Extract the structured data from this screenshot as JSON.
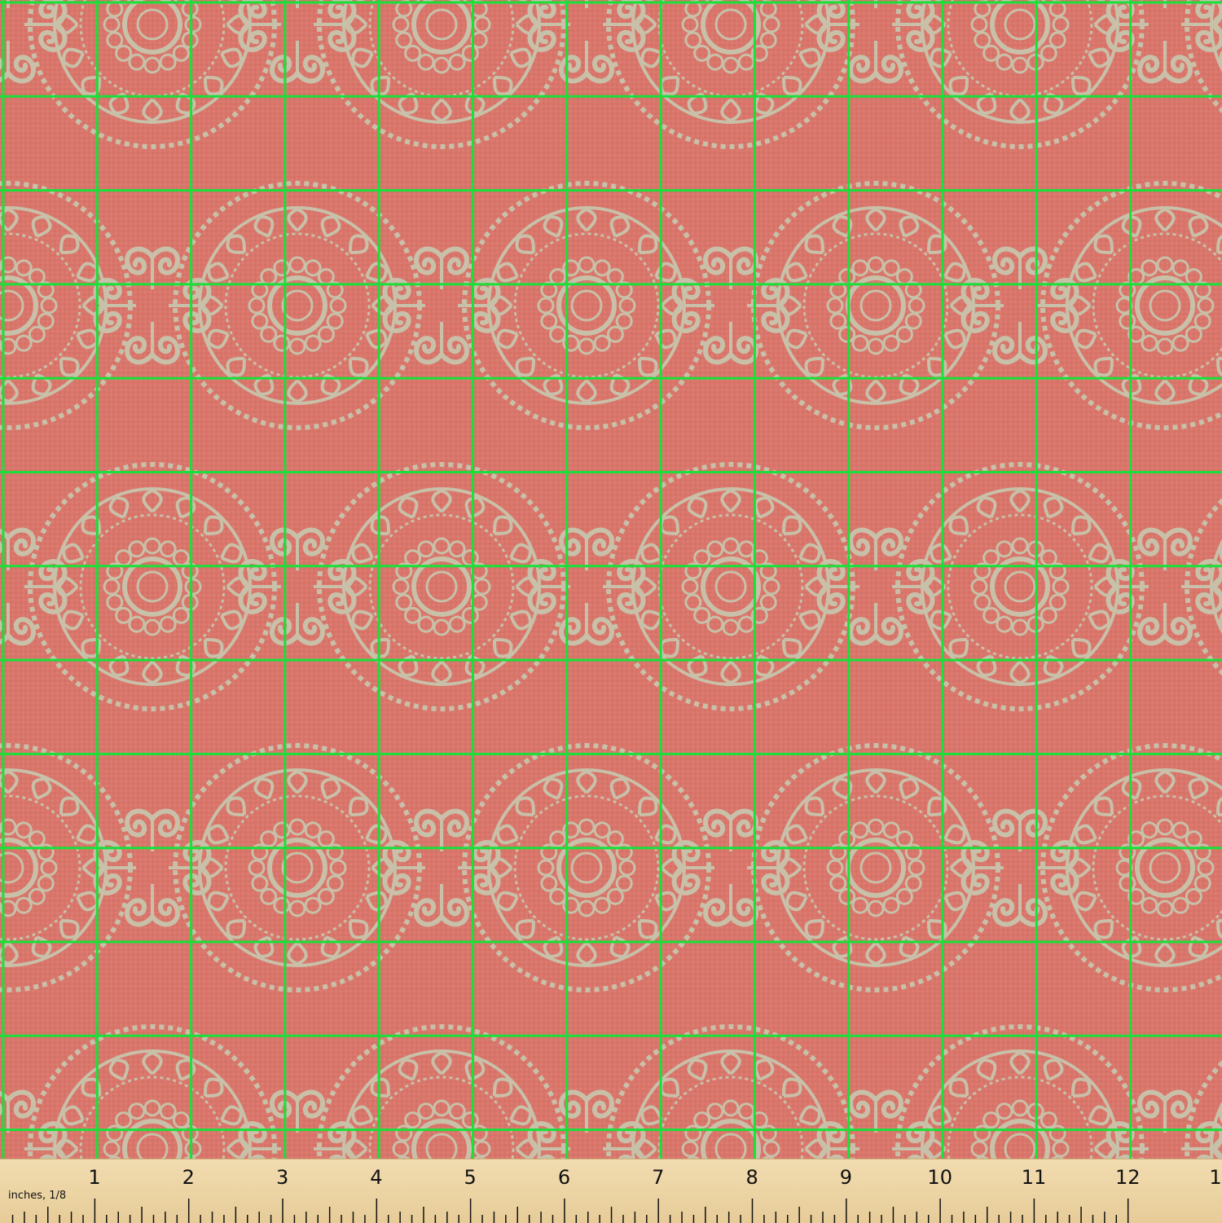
{
  "colors": {
    "fabric_background": "#d9766b",
    "motif": "#c8c0a8",
    "grid_line": "#19e03a",
    "ruler_wood": "#ecd4a4",
    "ruler_ink": "#111111"
  },
  "motif_icon": "medallion-swirl-pattern",
  "ruler": {
    "unit_label": "inches, 1/8",
    "numbers": [
      "1",
      "2",
      "3",
      "4",
      "5",
      "6",
      "7",
      "8",
      "9",
      "10",
      "11",
      "12",
      "1"
    ]
  }
}
